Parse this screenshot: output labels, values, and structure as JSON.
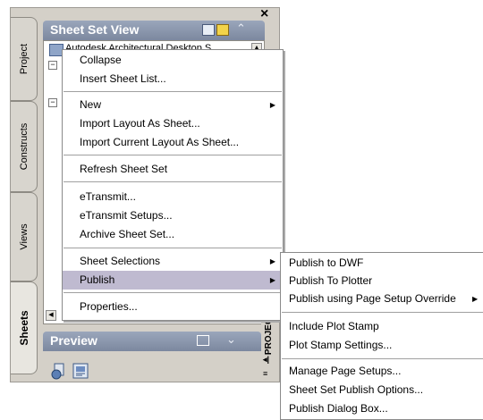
{
  "palette": {
    "tabs": [
      {
        "label": "Project",
        "active": false
      },
      {
        "label": "Constructs",
        "active": false
      },
      {
        "label": "Views",
        "active": false
      },
      {
        "label": "Sheets",
        "active": true
      }
    ],
    "sheet_set_view": {
      "title": "Sheet Set View",
      "tree_item": "Autodesk Architectural Desktop S"
    },
    "preview": {
      "title": "Preview"
    },
    "project_strip_label": "PROJEC"
  },
  "context_menu": {
    "items": [
      {
        "label": "Collapse"
      },
      {
        "label": "Insert Sheet List..."
      },
      {
        "label": "New",
        "submenu": true
      },
      {
        "label": "Import Layout As Sheet..."
      },
      {
        "label": "Import Current Layout As Sheet..."
      },
      {
        "label": "Refresh Sheet Set"
      },
      {
        "label": "eTransmit..."
      },
      {
        "label": "eTransmit Setups..."
      },
      {
        "label": "Archive Sheet Set..."
      },
      {
        "label": "Sheet Selections",
        "submenu": true
      },
      {
        "label": "Publish",
        "submenu": true,
        "highlighted": true
      },
      {
        "label": "Properties..."
      }
    ]
  },
  "publish_submenu": {
    "items": [
      {
        "label": "Publish to DWF"
      },
      {
        "label": "Publish To Plotter"
      },
      {
        "label": "Publish using Page Setup Override",
        "submenu": true
      },
      {
        "label": "Include Plot Stamp"
      },
      {
        "label": "Plot Stamp Settings..."
      },
      {
        "label": "Manage Page Setups..."
      },
      {
        "label": "Sheet Set Publish Options..."
      },
      {
        "label": "Publish Dialog Box..."
      }
    ]
  },
  "colors": {
    "title_bar": "#8a96ad",
    "highlight": "#bfbad0",
    "palette_bg": "#d4d0c8"
  }
}
